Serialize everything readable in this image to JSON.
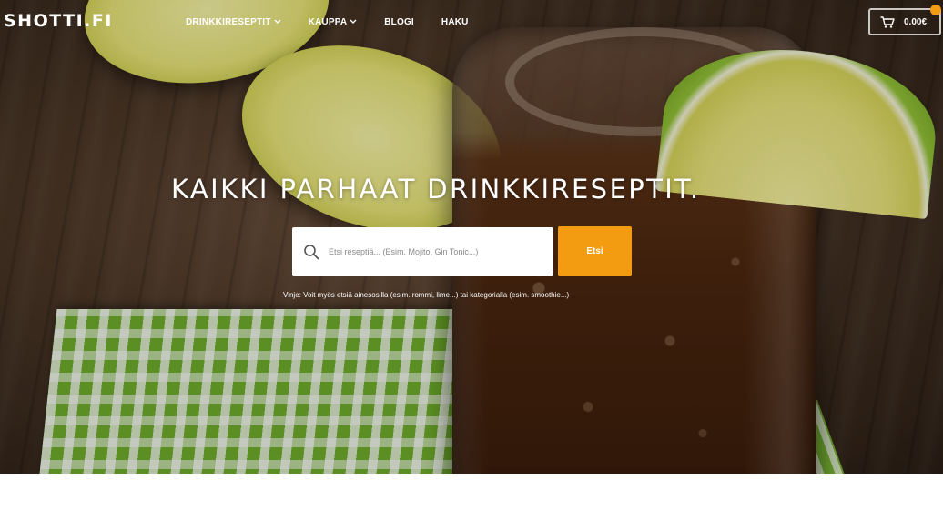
{
  "header": {
    "logo": "SHOTTI.FI",
    "nav": [
      {
        "label": "DRINKKIRESEPTIT",
        "has_dropdown": true
      },
      {
        "label": "KAUPPA",
        "has_dropdown": true
      },
      {
        "label": "BLOGI",
        "has_dropdown": false
      },
      {
        "label": "HAKU",
        "has_dropdown": false
      }
    ],
    "cart": {
      "amount": "0.00€",
      "icon": "cart-icon"
    }
  },
  "hero": {
    "headline": "KAIKKI PARHAAT DRINKKIRESEPTIT.",
    "search": {
      "placeholder": "Etsi reseptiä... (Esim. Mojito, Gin Tonic...)",
      "icon": "search-icon",
      "button_label": "Etsi"
    },
    "hint": "Vinje: Voit myös etsiä ainesosilla (esim. rommi, lime...) tai kategorialla (esim. smoothie...)"
  },
  "colors": {
    "accent": "#f39c12",
    "text_on_hero": "#ffffff"
  }
}
